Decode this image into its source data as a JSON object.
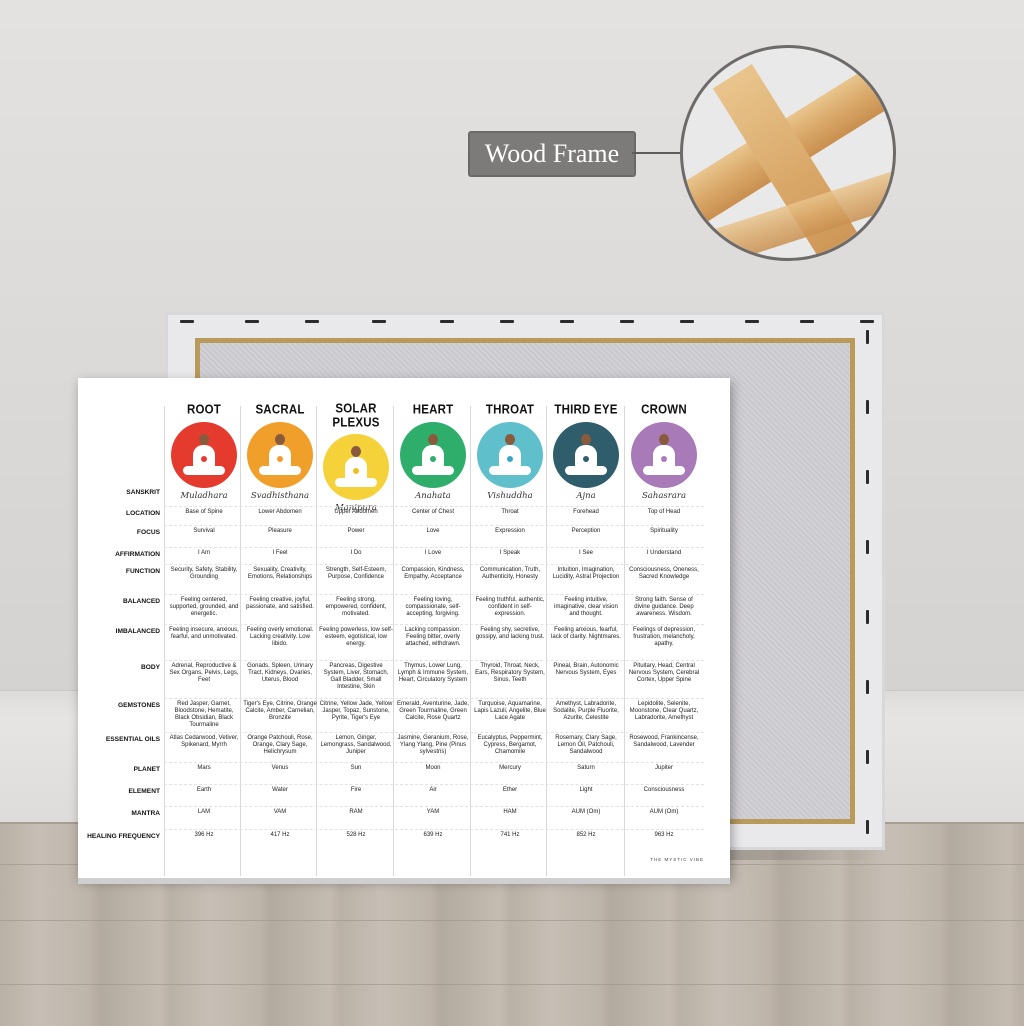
{
  "callout": {
    "label": "Wood Frame"
  },
  "chakras": [
    {
      "name": "ROOT",
      "sanskrit": "Muladhara",
      "color": "#e53b2f",
      "dot": "#e53b2f"
    },
    {
      "name": "SACRAL",
      "sanskrit": "Svadhisthana",
      "color": "#f0a02a",
      "dot": "#f29a2e"
    },
    {
      "name": "SOLAR PLEXUS",
      "sanskrit": "Manipura",
      "color": "#f6d23a",
      "dot": "#e8c21c"
    },
    {
      "name": "HEART",
      "sanskrit": "Anahata",
      "color": "#2fae6b",
      "dot": "#2fae6b"
    },
    {
      "name": "THROAT",
      "sanskrit": "Vishuddha",
      "color": "#5fbfcb",
      "dot": "#3ba7c6"
    },
    {
      "name": "THIRD EYE",
      "sanskrit": "Ajna",
      "color": "#2f5d6b",
      "dot": "#2f5d6b"
    },
    {
      "name": "CROWN",
      "sanskrit": "Sahasrara",
      "color": "#a87bb8",
      "dot": "#a87bb8"
    }
  ],
  "row_labels": [
    "SANSKRIT",
    "LOCATION",
    "FOCUS",
    "AFFIRMATION",
    "FUNCTION",
    "BALANCED",
    "IMBALANCED",
    "BODY",
    "GEMSTONES",
    "ESSENTIAL OILS",
    "PLANET",
    "ELEMENT",
    "MANTRA",
    "HEALING FREQUENCY"
  ],
  "rows": {
    "location": [
      "Base of Spine",
      "Lower Abdomen",
      "Upper Abdomen",
      "Center of Chest",
      "Throat",
      "Forehead",
      "Top of Head"
    ],
    "focus": [
      "Survival",
      "Pleasure",
      "Power",
      "Love",
      "Expression",
      "Perception",
      "Spirituality"
    ],
    "affirmation": [
      "I Am",
      "I Feel",
      "I Do",
      "I Love",
      "I Speak",
      "I See",
      "I Understand"
    ],
    "function": [
      "Security, Safety, Stability, Grounding",
      "Sexuality, Creativity, Emotions, Relationships",
      "Strength, Self-Esteem, Purpose, Confidence",
      "Compassion, Kindness, Empathy, Acceptance",
      "Communication, Truth, Authenticity, Honesty",
      "Intuition, Imagination, Lucidity, Astral Projection",
      "Consciousness, Oneness, Sacred Knowledge"
    ],
    "balanced": [
      "Feeling centered, supported, grounded, and energetic.",
      "Feeling creative, joyful, passionate, and satisfied.",
      "Feeling strong, empowered, confident, motivated.",
      "Feeling loving, compassionate, self-accepting, forgiving.",
      "Feeling truthful, authentic, confident in self-expression.",
      "Feeling intuitive, imaginative, clear vision and thought.",
      "Strong faith. Sense of divine guidance. Deep awareness. Wisdom."
    ],
    "imbalanced": [
      "Feeling insecure, anxious, fearful, and unmotivated.",
      "Feeling overly emotional. Lacking creativity. Low libido.",
      "Feeling powerless, low self-esteem, egotistical, low energy.",
      "Lacking compassion. Feeling bitter, overly attached, withdrawn.",
      "Feeling shy, secretive, gossipy, and lacking trust.",
      "Feeling anxious, fearful, lack of clarity. Nightmares.",
      "Feelings of depression, frustration, melancholy, apathy."
    ],
    "body": [
      "Adrenal, Reproductive & Sex Organs, Pelvis, Legs, Feet",
      "Gonads, Spleen, Urinary Tract, Kidneys, Ovaries, Uterus, Blood",
      "Pancreas, Digestive System, Liver, Stomach, Gall Bladder, Small Intestine, Skin",
      "Thymus, Lower Lung, Lymph & Immune System, Heart, Circulatory System",
      "Thyroid, Throat, Neck, Ears, Respiratory System, Sinus, Teeth",
      "Pineal, Brain, Autonomic Nervous System, Eyes",
      "Pituitary, Head, Central Nervous System, Cerebral Cortex, Upper Spine"
    ],
    "gemstones": [
      "Red Jasper, Garnet, Bloodstone, Hematite, Black Obsidian, Black Tourmaline",
      "Tiger's Eye, Citrine, Orange Calcite, Amber, Carnelian, Bronzite",
      "Citrine, Yellow Jade, Yellow Jasper, Topaz, Sunstone, Pyrite, Tiger's Eye",
      "Emerald, Aventurine, Jade, Green Tourmaline, Green Calcite, Rose Quartz",
      "Turquoise, Aquamarine, Lapis Lazuli, Angelite, Blue Lace Agate",
      "Amethyst, Labradorite, Sodalite, Purple Fluorite, Azurite, Celestite",
      "Lepidolite, Selenite, Moonstone, Clear Quartz, Labradorite, Amethyst"
    ],
    "oils": [
      "Atlas Cedarwood, Vetiver, Spikenard, Myrrh",
      "Orange Patchouli, Rose, Orange, Clary Sage, Helichrysum",
      "Lemon, Ginger, Lemongrass, Sandalwood, Juniper",
      "Jasmine, Geranium, Rose, Ylang Ylang, Pine (Pinus sylvestris)",
      "Eucalyptus, Peppermint, Cypress, Bergamot, Chamomile",
      "Rosemary, Clary Sage, Lemon Oil, Patchouli, Sandalwood",
      "Rosewood, Frankincense, Sandalwood, Lavender"
    ],
    "planet": [
      "Mars",
      "Venus",
      "Sun",
      "Moon",
      "Mercury",
      "Saturn",
      "Jupiter"
    ],
    "element": [
      "Earth",
      "Water",
      "Fire",
      "Air",
      "Ether",
      "Light",
      "Consciousness"
    ],
    "mantra": [
      "LAM",
      "VAM",
      "RAM",
      "YAM",
      "HAM",
      "AUM (Om)",
      "AUM (Om)"
    ],
    "frequency": [
      "396 Hz",
      "417 Hz",
      "528 Hz",
      "639 Hz",
      "741 Hz",
      "852 Hz",
      "963 Hz"
    ]
  },
  "brand": "THE MYSTIC VIBE"
}
